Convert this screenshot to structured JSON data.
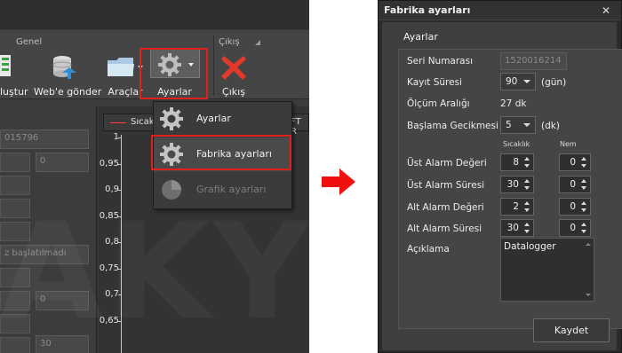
{
  "ribbon": {
    "group_general": "Genel",
    "group_exit": "Çıkış",
    "btn_create": "luştur",
    "btn_web": "Web'e gönder",
    "btn_tools": "Araçlar",
    "btn_settings": "Ayarlar",
    "btn_exit": "Çıkış"
  },
  "left_form": {
    "serial_partial": "015796",
    "zero1": "0",
    "not_started": "z başlatılmadı",
    "zero2": "0",
    "thirty": "30"
  },
  "chart_data": {
    "type": "line",
    "legend": [
      "Sıcak",
      "FT R"
    ],
    "y_ticks": [
      "1",
      "0,95",
      "0,9",
      "0,85",
      "0,8",
      "0,75",
      "0,7",
      "0,65"
    ],
    "series": []
  },
  "menu": {
    "items": [
      {
        "label": "Ayarlar",
        "enabled": true
      },
      {
        "label": "Fabrika ayarları",
        "enabled": true,
        "highlighted": true
      },
      {
        "label": "Grafik ayarları",
        "enabled": false
      }
    ]
  },
  "watermark": "AKYOU",
  "dialog": {
    "title": "Fabrika ayarları",
    "group_title": "Ayarlar",
    "serial_label": "Seri Numarası",
    "serial_value": "1520016214",
    "record_label": "Kayıt Süresi",
    "record_value": "90",
    "record_unit": "(gün)",
    "interval_label": "Ölçüm Aralığı",
    "interval_value": "27 dk",
    "delay_label": "Başlama Gecikmesi",
    "delay_value": "5",
    "delay_unit": "(dk)",
    "col_temp": "Sıcaklık",
    "col_hum": "Nem",
    "upper_alarm_value_label": "Üst Alarm Değeri",
    "upper_alarm_value_temp": "8",
    "upper_alarm_value_hum": "0",
    "upper_alarm_time_label": "Üst Alarm Süresi",
    "upper_alarm_time_temp": "30",
    "upper_alarm_time_hum": "0",
    "lower_alarm_value_label": "Alt Alarm Değeri",
    "lower_alarm_value_temp": "2",
    "lower_alarm_value_hum": "0",
    "lower_alarm_time_label": "Alt Alarm Süresi",
    "lower_alarm_time_temp": "30",
    "lower_alarm_time_hum": "0",
    "description_label": "Açıklama",
    "description_value": "Datalogger",
    "save_label": "Kaydet",
    "close_glyph": "✕"
  },
  "colors": {
    "highlight_red": "#e0201f",
    "arrow_red": "#f01010"
  }
}
